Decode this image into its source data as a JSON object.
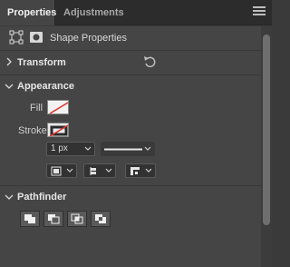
{
  "tabs": [
    {
      "label": "Properties",
      "active": true
    },
    {
      "label": "Adjustments",
      "active": false
    }
  ],
  "header": {
    "title": "Shape Properties"
  },
  "sections": {
    "transform": {
      "label": "Transform"
    },
    "appearance": {
      "label": "Appearance"
    },
    "pathfinder": {
      "label": "Pathfinder"
    }
  },
  "appearance": {
    "fill_label": "Fill",
    "stroke_label": "Stroke",
    "stroke_width": "1 px"
  },
  "colors": {
    "panel_bg": "#454545",
    "tab_bar_bg": "#2c2c2c",
    "none_slash": "#e0312b"
  }
}
